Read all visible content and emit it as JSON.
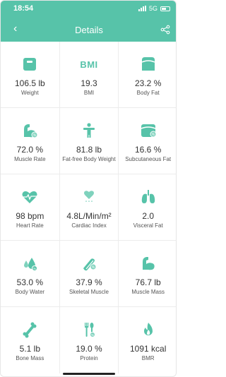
{
  "status": {
    "time": "18:54",
    "network": "5G"
  },
  "header": {
    "title": "Details"
  },
  "colors": {
    "accent": "#57c3a9"
  },
  "metrics": [
    {
      "value": "106.5 lb",
      "label": "Weight",
      "icon": "scale-icon"
    },
    {
      "value": "19.3",
      "label": "BMI",
      "icon": "bmi-icon",
      "icon_text": "BMI"
    },
    {
      "value": "23.2 %",
      "label": "Body Fat",
      "icon": "body-fat-icon"
    },
    {
      "value": "72.0 %",
      "label": "Muscle Rate",
      "icon": "muscle-rate-icon"
    },
    {
      "value": "81.8 lb",
      "label": "Fat-free Body Weight",
      "icon": "fat-free-body-icon"
    },
    {
      "value": "16.6 %",
      "label": "Subcutaneous Fat",
      "icon": "subcutaneous-fat-icon"
    },
    {
      "value": "98 bpm",
      "label": "Heart Rate",
      "icon": "heart-rate-icon"
    },
    {
      "value": "4.8L/Min/m²",
      "label": "Cardiac Index",
      "icon": "cardiac-index-icon"
    },
    {
      "value": "2.0",
      "label": "Visceral Fat",
      "icon": "lungs-icon"
    },
    {
      "value": "53.0 %",
      "label": "Body Water",
      "icon": "water-drops-icon"
    },
    {
      "value": "37.9 %",
      "label": "Skeletal Muscle",
      "icon": "skeletal-muscle-icon"
    },
    {
      "value": "76.7 lb",
      "label": "Muscle Mass",
      "icon": "muscle-mass-icon"
    },
    {
      "value": "5.1 lb",
      "label": "Bone Mass",
      "icon": "bone-icon"
    },
    {
      "value": "19.0 %",
      "label": "Protein",
      "icon": "protein-icon"
    },
    {
      "value": "1091 kcal",
      "label": "BMR",
      "icon": "flame-icon"
    }
  ]
}
